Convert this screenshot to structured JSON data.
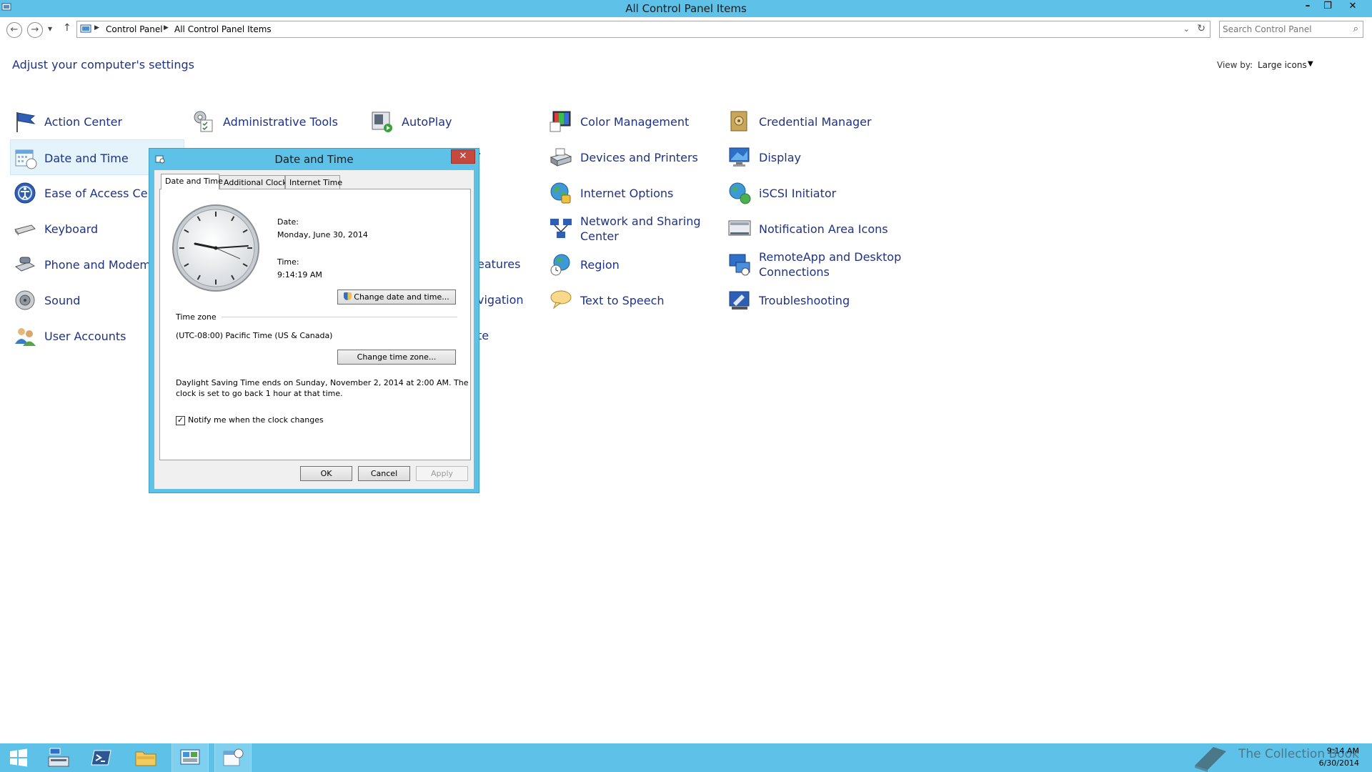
{
  "window": {
    "title": "All Control Panel Items",
    "minimize": "–",
    "restore": "❐",
    "close": "✕"
  },
  "address": {
    "back": "←",
    "forward": "→",
    "history": "▾",
    "up": "↑",
    "crumbs": [
      "Control Panel",
      "All Control Panel Items"
    ],
    "refresh": "↻",
    "dropdown": "⌄"
  },
  "search": {
    "placeholder": "Search Control Panel"
  },
  "content": {
    "heading": "Adjust your computer's settings",
    "view_by_label": "View by:",
    "view_by_value": "Large icons"
  },
  "items": {
    "action_center": "Action Center",
    "admin_tools": "Administrative Tools",
    "autoplay": "AutoPlay",
    "color_mgmt": "Color Management",
    "credential_mgr": "Credential Manager",
    "date_time": "Date and Time",
    "devices_printers": "Devices and Printers",
    "display": "Display",
    "ease_access": "Ease of Access Center",
    "internet_options": "Internet Options",
    "iscsi": "iSCSI Initiator",
    "keyboard": "Keyboard",
    "network_sharing": "Network and Sharing Center",
    "notification_icons": "Notification Area Icons",
    "phone_modem": "Phone and Modem",
    "region": "Region",
    "remoteapp": "RemoteApp and Desktop Connections",
    "sound": "Sound",
    "text_speech": "Text to Speech",
    "troubleshooting": "Troubleshooting",
    "user_accounts": "User Accounts",
    "partial_features": "eatures",
    "partial_navigation": "vigation",
    "partial_te": "te"
  },
  "dialog": {
    "title": "Date and Time",
    "close": "✕",
    "tabs": [
      "Date and Time",
      "Additional Clocks",
      "Internet Time"
    ],
    "date_label": "Date:",
    "date_value": "Monday, June 30, 2014",
    "time_label": "Time:",
    "time_value": "9:14:19 AM",
    "change_datetime_btn": "Change date and time...",
    "timezone_heading": "Time zone",
    "timezone_value": "(UTC-08:00) Pacific Time (US & Canada)",
    "change_tz_btn": "Change time zone...",
    "dst_line1": "Daylight Saving Time ends on Sunday, November 2, 2014 at 2:00 AM. The",
    "dst_line2": "clock is set to go back 1 hour at that time.",
    "notify_checked": "✓",
    "notify_label": "Notify me when the clock changes",
    "ok": "OK",
    "cancel": "Cancel",
    "apply": "Apply"
  },
  "taskbar": {
    "time": "9:14 AM",
    "date": "6/30/2014",
    "watermark": "The Collection Book"
  },
  "colors": {
    "titlebar": "#5ec1e7",
    "link": "#1e3287",
    "close_button": "#c7493d"
  }
}
